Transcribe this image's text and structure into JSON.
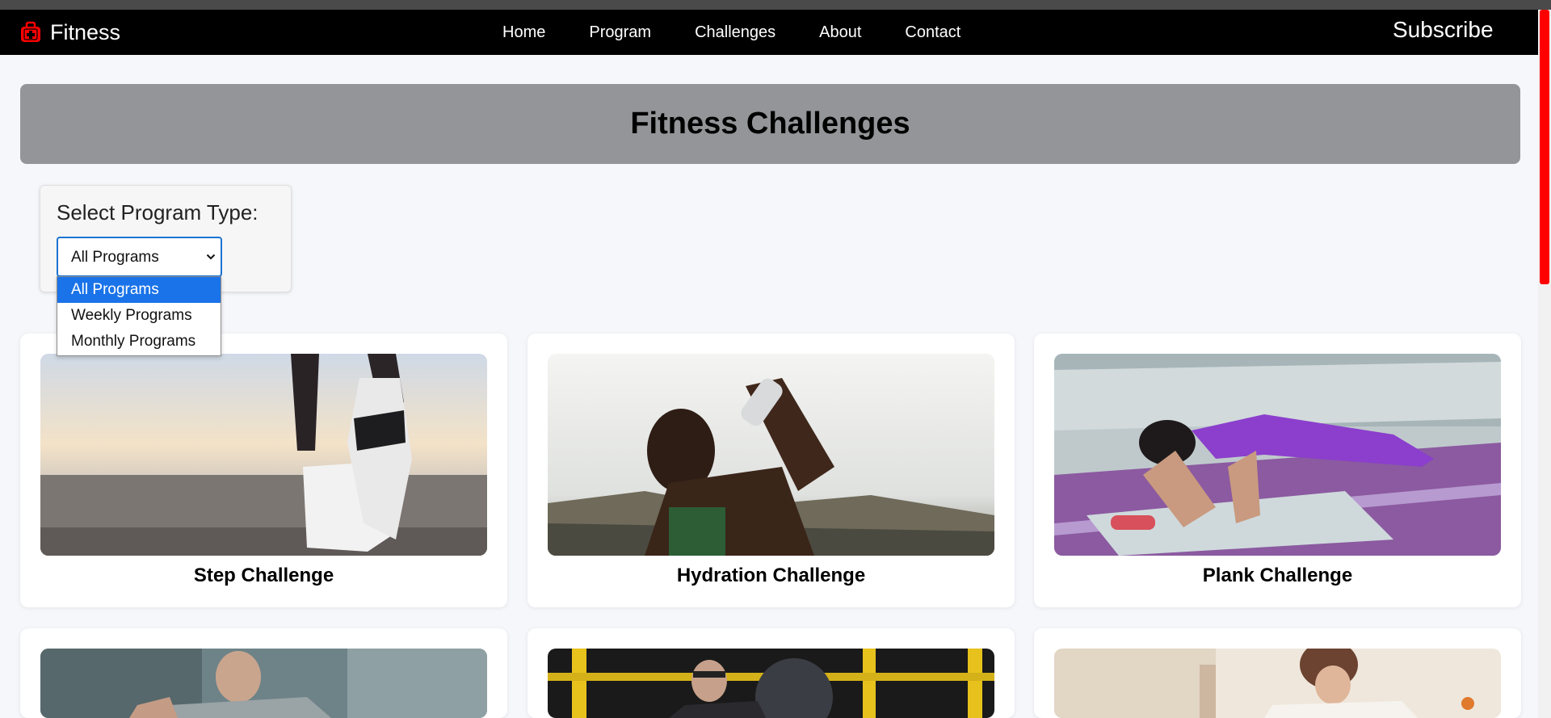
{
  "brand": {
    "name": "Fitness",
    "icon": "first-aid-kit-icon",
    "accent": "#ff0000"
  },
  "nav": {
    "links": [
      "Home",
      "Program",
      "Challenges",
      "About",
      "Contact"
    ],
    "subscribe_label": "Subscribe",
    "background": "#000000"
  },
  "hero": {
    "title": "Fitness Challenges",
    "background": "#939598"
  },
  "filter": {
    "label": "Select Program Type:",
    "selected": "All Programs",
    "options": [
      "All Programs",
      "Weekly Programs",
      "Monthly Programs"
    ],
    "highlight_color": "#1a73e8"
  },
  "cards": [
    {
      "title": "Step Challenge",
      "image": "running-shoe-photo"
    },
    {
      "title": "Hydration Challenge",
      "image": "athlete-drinking-water-photo"
    },
    {
      "title": "Plank Challenge",
      "image": "woman-planking-photo"
    },
    {
      "title": "",
      "image": "man-stretching-photo"
    },
    {
      "title": "",
      "image": "medicine-ball-workout-photo"
    },
    {
      "title": "",
      "image": "woman-healthy-snack-photo"
    }
  ]
}
